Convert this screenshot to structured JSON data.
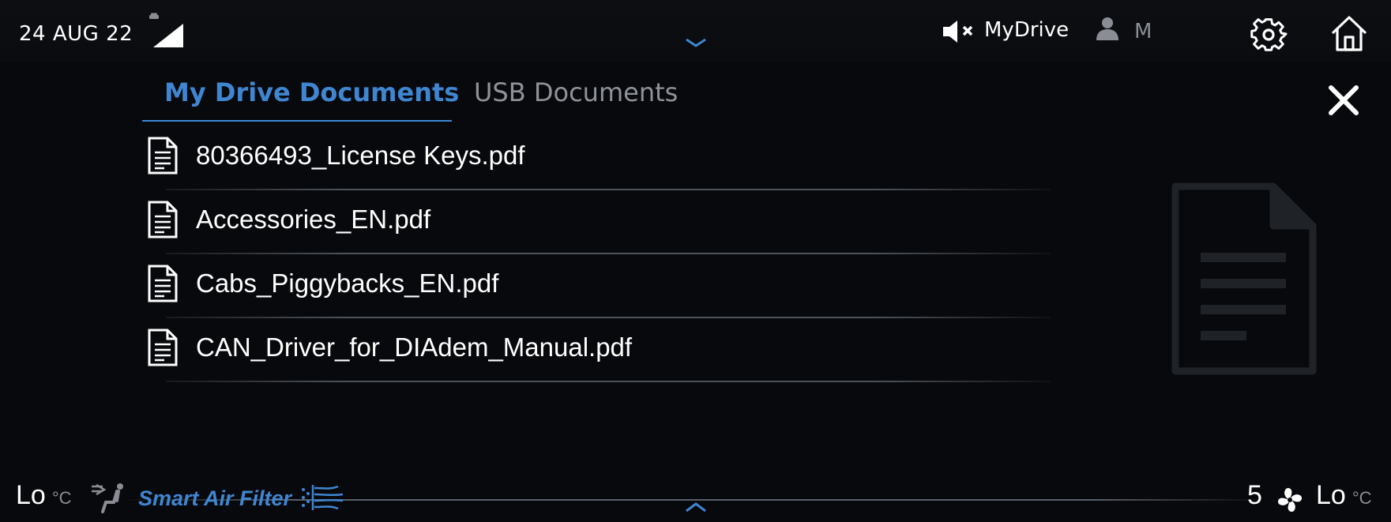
{
  "status_bar": {
    "date": "24 AUG 22",
    "signal_icon": "signal-strength-icon",
    "audio_icon": "speaker-muted-icon",
    "profile_name": "MyDrive",
    "user_initial": "M",
    "settings_icon": "gear-icon",
    "home_icon": "home-icon"
  },
  "tabs": [
    {
      "label": "My Drive Documents",
      "active": true
    },
    {
      "label": "USB Documents",
      "active": false
    }
  ],
  "files": [
    {
      "name": "80366493_License Keys.pdf"
    },
    {
      "name": "Accessories_EN.pdf"
    },
    {
      "name": "Cabs_Piggybacks_EN.pdf"
    },
    {
      "name": "CAN_Driver_for_DIAdem_Manual.pdf"
    }
  ],
  "climate": {
    "left_temp": "Lo",
    "left_unit": "°C",
    "smart_air_label": "Smart Air Filter",
    "fan_speed": "5",
    "right_temp": "Lo",
    "right_unit": "°C"
  },
  "colors": {
    "accent": "#3f86d2",
    "inactive_tab": "#8f9399",
    "background": "#07090c",
    "divider": "#4d535b"
  }
}
